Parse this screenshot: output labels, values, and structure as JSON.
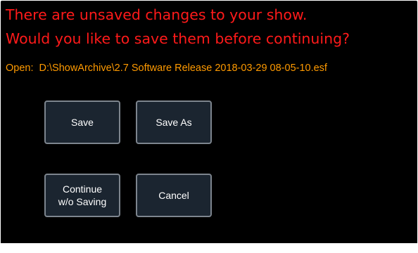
{
  "dialog": {
    "message_line1": "There are unsaved changes to your show.",
    "message_line2": "Would you like to save them before continuing?",
    "open_label": "Open:",
    "open_path": "D:\\ShowArchive\\2.7 Software Release 2018-03-29 08-05-10.esf",
    "colors": {
      "background": "#000000",
      "message": "#ff1a1a",
      "path_text": "#ff9a00",
      "button_fill": "#1b2530",
      "button_border": "#7d858e"
    }
  },
  "buttons": {
    "save": "Save",
    "save_as": "Save As",
    "continue_line1": "Continue",
    "continue_line2": "w/o Saving",
    "cancel": "Cancel"
  }
}
